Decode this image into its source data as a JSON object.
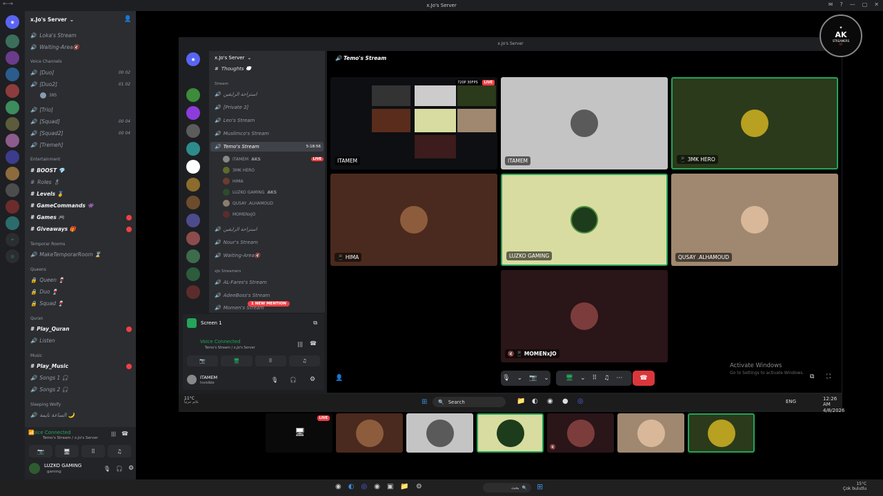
{
  "window": {
    "title": "x.Jo's Server"
  },
  "server": {
    "name": "x.Jo's Server"
  },
  "outer_channels": {
    "top_items": [
      "Loka's Stream",
      "Waiting-Area🔇"
    ],
    "voice_category": "Voice Channels",
    "voice": [
      {
        "name": "[Duo]",
        "counts": "00 02"
      },
      {
        "name": "[Duo2]",
        "counts": "01 02"
      },
      {
        "name": "[Trio]",
        "counts": ""
      },
      {
        "name": "[Squad]",
        "counts": "00 04"
      },
      {
        "name": "[Squad2]",
        "counts": "00 04"
      },
      {
        "name": "[Tremeh]",
        "counts": ""
      }
    ],
    "duo2_member": "385",
    "ent_category": "Entertainment",
    "text": [
      {
        "name": "BOOST 💎",
        "unread": false
      },
      {
        "name": "Roles 🎖",
        "unread": false
      },
      {
        "name": "Levels 🏅",
        "unread": false
      },
      {
        "name": "GameCommands 👾",
        "unread": false
      },
      {
        "name": "Games 🎮",
        "unread": true
      },
      {
        "name": "Giveaways 🎁",
        "unread": true
      }
    ],
    "temp_category": "Temporar Rooms",
    "temp": [
      "MakeTemporarRoom ⌛"
    ],
    "queens_category": "Queens",
    "queens": [
      "Queen 🍷",
      "Duo 🍷",
      "Squad 🍷"
    ],
    "quran_category": "Quran",
    "quran": [
      {
        "name": "Play_Quran",
        "unread": true
      },
      {
        "name": "Listen",
        "unread": false
      }
    ],
    "music_category": "Music",
    "music": [
      {
        "name": "Play_Music",
        "unread": true
      },
      {
        "name": "Songs 1 🎧",
        "unread": false
      },
      {
        "name": "Songs 2 🎧",
        "unread": false
      }
    ],
    "sleep_category": "Sleeping Wolfy",
    "sleep": [
      "الساعة نايمة 🌙"
    ]
  },
  "outer_voice": {
    "status": "Voice Connected",
    "sub": "Temo's Stream / x.Jo's Server"
  },
  "outer_user": {
    "name": "LUZKO GAMING",
    "status": "gaming"
  },
  "inner_header": {
    "title": "x.Jo's Server"
  },
  "inner_channels": {
    "server": "x.Jo's Server",
    "top": "Thoughts 💭",
    "stream_category": "Stream",
    "items": [
      "استراحة الرايقين",
      "[Private 2]",
      "Leo's Stream",
      "Muslimco's Stream"
    ],
    "active": "Temo's Stream",
    "active_time": "5:18:56",
    "members": [
      {
        "name": "ITAMEM",
        "tag": "AKS",
        "live": true
      },
      {
        "name": "3MK HERO",
        "tag": "",
        "live": false
      },
      {
        "name": "HIMA",
        "tag": "",
        "live": false
      },
      {
        "name": "LUZKO GAMING",
        "tag": "AKS",
        "live": false
      },
      {
        "name": "QUSAY .ALHAMOUD",
        "tag": "",
        "live": false
      },
      {
        "name": "MOMENxJO",
        "tag": "",
        "live": false
      }
    ],
    "after": [
      "استراحة الرايقين",
      "Nour's Stream",
      "Waiting-Area🔇"
    ],
    "streamers_category": "xJo Streamers",
    "streamers": [
      "AL-Fares's Stream",
      "AdeeBoss's Stream",
      "Momen's Stream"
    ],
    "mention": "1 NEW MENTION",
    "live_label": "LIVE"
  },
  "inner_panel": {
    "screen": "Screen 1",
    "status": "Voice Connected",
    "sub": "Temo's Stream / x.Jo's Server",
    "user": "ITAMEM",
    "user_status": "Invisible"
  },
  "stage": {
    "title": "Temo's Stream",
    "stream_quality": "720P 30FPS",
    "live": "LIVE",
    "tiles": [
      "ITAMEM",
      "ITAMEM",
      "3MK HERO",
      "HIMA",
      "LUZKO GAMING",
      "QUSAY .ALHAMOUD",
      "MOMENxJO"
    ]
  },
  "inner_taskbar": {
    "search": "Search",
    "lang": "ENG",
    "time": "12:26 AM",
    "date": "4/8/2026",
    "weather": "11°C",
    "weather_sub": "غائم جزئياً"
  },
  "strip": {
    "live": "LIVE"
  },
  "watermark": {
    "title": "Activate Windows",
    "sub": "Go to Settings to activate Windows."
  },
  "logo": {
    "line1": "AK",
    "line2": "STREAMERS",
    "line3": "RP"
  },
  "os_taskbar": {
    "search": "بحث",
    "weather": "15°C",
    "weather_sub": "Çok bulutlu"
  },
  "colors": {
    "accent": "#5865f2",
    "green": "#23a55a",
    "red": "#f23f43",
    "danger": "#da373c"
  }
}
